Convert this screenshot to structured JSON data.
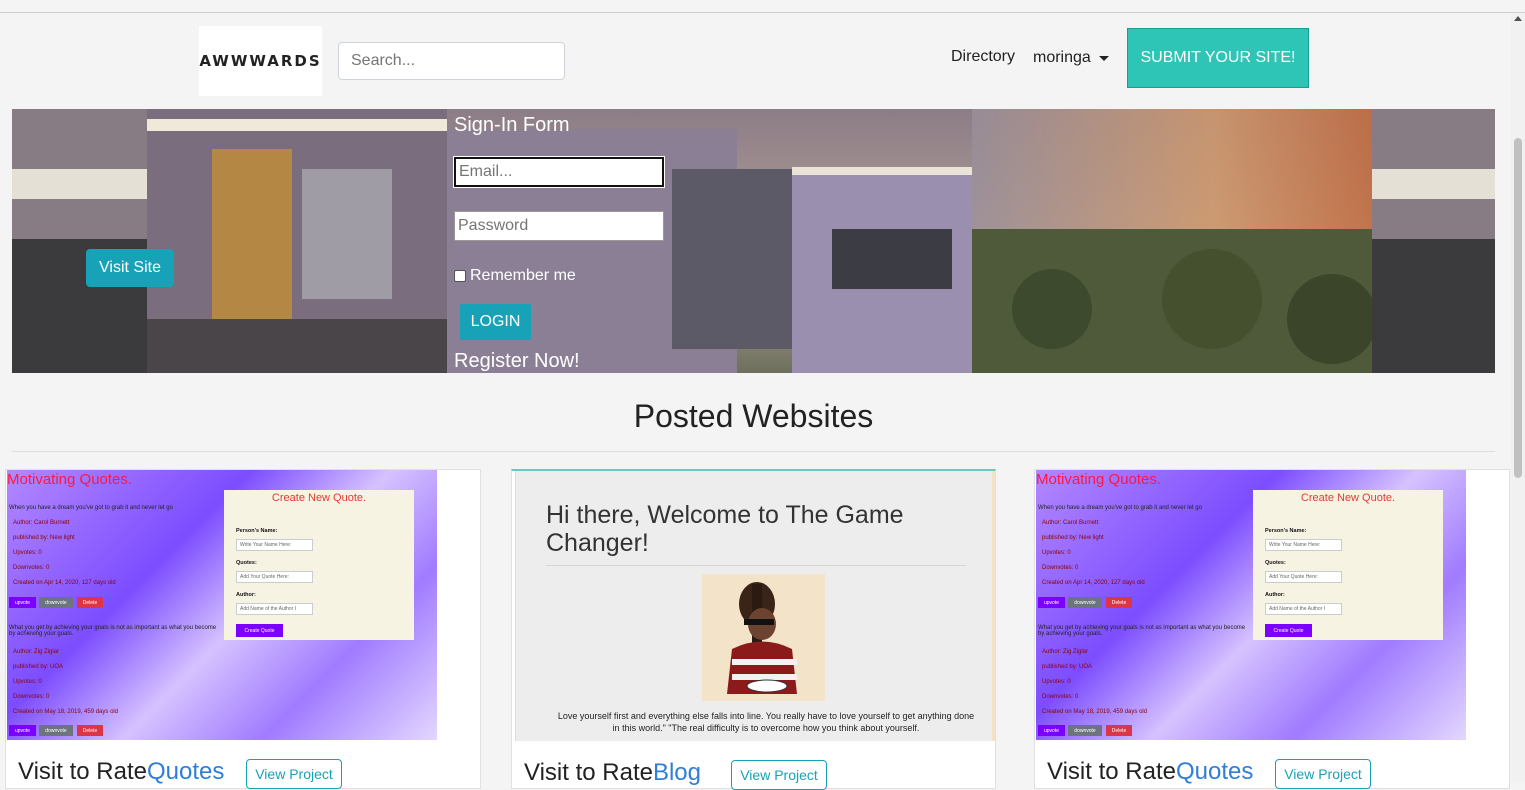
{
  "header": {
    "logo_text": "AWWWARDS",
    "search_placeholder": "Search...",
    "directory_label": "Directory",
    "user_label": "moringa",
    "submit_label": "SUBMIT YOUR SITE!"
  },
  "hero": {
    "visit_label": "Visit Site",
    "form_title": "Sign-In Form",
    "email_placeholder": "Email...",
    "password_placeholder": "Password",
    "remember_label": "Remember me",
    "login_label": "LOGIN",
    "register_label": "Register Now!"
  },
  "section_title": "Posted Websites",
  "quotes_thumb": {
    "title": "Motivating Quotes.",
    "quote1": "When you have a dream you've got to grab it and never let go",
    "author1": "Author: Carol Burnett",
    "published1": "published by: New light",
    "upvotes1": "Upvotes: 0",
    "downvotes1": "Downvotes: 0",
    "created1": "Created on Apr 14, 2020, 127 days old",
    "quote2": "What you get by achieving your goals is not as important as what you become by achieving your goals.",
    "author2": "Author: Zig Ziglar",
    "published2": "published by: UOA",
    "upvotes2": "Upvotes: 0",
    "downvotes2": "Downvotes: 0",
    "created2": "Created on May 18, 2019, 459 days old",
    "btn_upvote": "upvote",
    "btn_downvote": "downvote",
    "btn_delete": "Delete",
    "panel_title": "Create New Quote.",
    "label_name": "Person's Name:",
    "ph_name": "Write Your Name Here:",
    "label_quotes": "Quotes:",
    "ph_quote": "Add Your Quote Here:",
    "label_author": "Author:",
    "ph_author": "Add Name of the Author I",
    "create_btn": "Create Quote"
  },
  "blog_thumb": {
    "title": "Hi there, Welcome to The Game Changer!",
    "text": "Love yourself first and everything else falls into line. You really have to love yourself to get anything done in this world.\" \"The real difficulty is to overcome how you think about yourself."
  },
  "cards": [
    {
      "prefix": "Visit to Rate",
      "link": "Quotes",
      "button": "View Project"
    },
    {
      "prefix": "Visit to Rate",
      "link": "Blog",
      "button": "View Project"
    },
    {
      "prefix": "Visit to Rate",
      "link": "Quotes",
      "button": "View Project"
    }
  ]
}
